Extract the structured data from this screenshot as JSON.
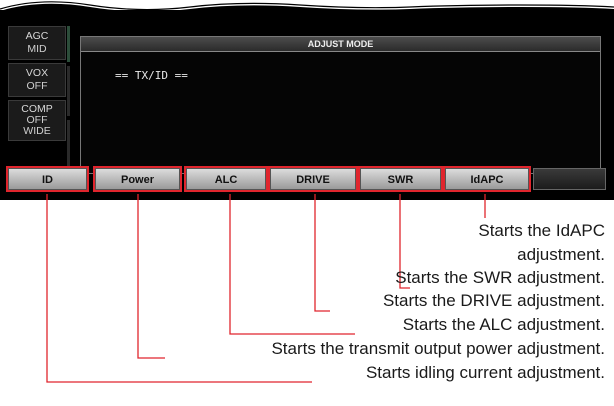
{
  "side_panel": [
    {
      "label": "AGC",
      "value": "MID"
    },
    {
      "label": "VOX",
      "value": "OFF"
    },
    {
      "label": "COMP",
      "value": "OFF",
      "value2": "WIDE"
    }
  ],
  "main_panel": {
    "title": "ADJUST MODE",
    "status_line": "== TX/ID =="
  },
  "softkeys": [
    {
      "label": "ID"
    },
    {
      "label": "Power"
    },
    {
      "label": "ALC"
    },
    {
      "label": "DRIVE"
    },
    {
      "label": "SWR"
    },
    {
      "label": "IdAPC"
    },
    {
      "label": ""
    }
  ],
  "annotations": {
    "idapc_1": "Starts the IdAPC",
    "idapc_2": "adjustment.",
    "swr": "Starts the SWR adjustment.",
    "drive": "Starts the DRIVE adjustment.",
    "alc": "Starts the ALC adjustment.",
    "power": "Starts the transmit output power adjustment.",
    "id": "Starts idling current adjustment."
  },
  "colors": {
    "highlight": "#e0252d",
    "screen_bg": "#000000",
    "key_bg": "#bdbdbd"
  }
}
